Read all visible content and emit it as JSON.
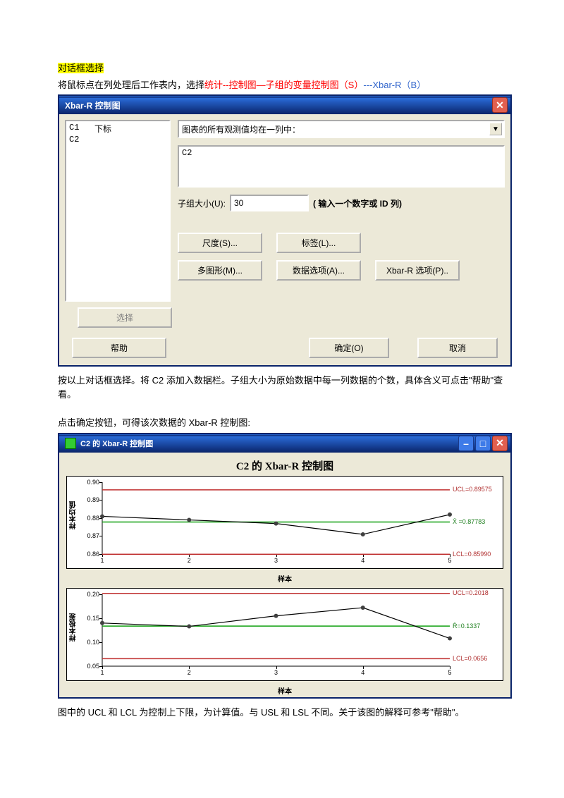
{
  "doc": {
    "heading_hl": "对话框选择",
    "line1a": "将鼠标点在列处理后工作表内，选择",
    "line1b_red": "统计--控制图—子组的变量控制图（S）",
    "line1c_blue": "---Xbar-R（B）",
    "para2": "按以上对话框选择。将 C2 添加入数据栏。子组大小为原始数据中每一列数据的个数，具体含义可点击\"帮助\"查看。",
    "para3": "点击确定按钮，可得该次数据的 Xbar-R 控制图:",
    "para4": "图中的 UCL 和 LCL 为控制上下限，为计算值。与 USL 和 LSL 不同。关于该图的解释可参考\"帮助\"。"
  },
  "dlg1": {
    "title": "Xbar-R 控制图",
    "list_c1": "C1",
    "list_c2": "C2",
    "list_h2": "下标",
    "dropdown_label": "图表的所有观测值均在一列中：",
    "data_value": "C2",
    "subgroup_label": "子组大小(U):",
    "subgroup_value": "30",
    "subgroup_hint": "( 输入一个数字或 ID 列)",
    "btn": {
      "scale": "尺度(S)...",
      "labels": "标签(L)...",
      "multi": "多图形(M)...",
      "dataopt": "数据选项(A)...",
      "xbaropt": "Xbar-R 选项(P)..",
      "select": "选择",
      "help": "帮助",
      "ok": "确定(O)",
      "cancel": "取消"
    }
  },
  "chartwin": {
    "title": "C2 的 Xbar-R 控制图",
    "chart_title": "C2 的 Xbar-R 控制图",
    "y1label": "样本均值",
    "y2label": "样本极差",
    "xlabel": "样本"
  },
  "chart_data": [
    {
      "type": "line",
      "panel": "xbar",
      "title": "样本均值",
      "xlabel": "样本",
      "x": [
        1,
        2,
        3,
        4,
        5
      ],
      "values": [
        0.881,
        0.879,
        0.877,
        0.871,
        0.882
      ],
      "yticks": [
        0.86,
        0.87,
        0.88,
        0.89,
        0.9
      ],
      "xticks": [
        1,
        2,
        3,
        4,
        5
      ],
      "ucl": 0.89575,
      "center": 0.87783,
      "center_label": "X̄ =0.87783",
      "lcl": 0.8599,
      "ucl_label": "UCL=0.89575",
      "lcl_label": "LCL=0.85990",
      "ylim": [
        0.86,
        0.9
      ]
    },
    {
      "type": "line",
      "panel": "r",
      "title": "样本极差",
      "xlabel": "样本",
      "x": [
        1,
        2,
        3,
        4,
        5
      ],
      "values": [
        0.14,
        0.133,
        0.155,
        0.172,
        0.108
      ],
      "yticks": [
        0.05,
        0.1,
        0.15,
        0.2
      ],
      "xticks": [
        1,
        2,
        3,
        4,
        5
      ],
      "ucl": 0.2018,
      "center": 0.1337,
      "center_label": "R̄=0.1337",
      "lcl": 0.0656,
      "ucl_label": "UCL=0.2018",
      "lcl_label": "LCL=0.0656",
      "ylim": [
        0.05,
        0.2
      ]
    }
  ]
}
